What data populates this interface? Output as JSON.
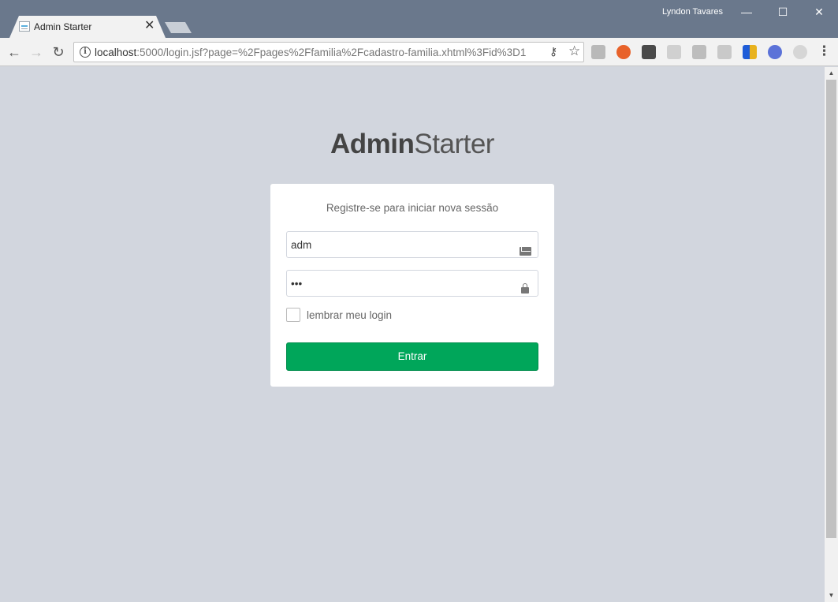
{
  "browser": {
    "tab": {
      "title": "Admin Starter",
      "close": "✕"
    },
    "profile_name": "Lyndon Tavares",
    "window_controls": {
      "minimize": "—",
      "maximize": "☐",
      "close": "✕"
    },
    "nav": {
      "back": "←",
      "forward": "→",
      "reload": "↻"
    },
    "address": {
      "host": "localhost",
      "rest": ":5000/login.jsf?page=%2Fpages%2Ffamilia%2Fcadastro-familia.xhtml%3Fid%3D1"
    },
    "extensions": [
      "acrobat-icon",
      "extension-orange-icon",
      "pocket-icon",
      "extension-gray-icon",
      "camera-icon",
      "extension-doc-icon",
      "extension-color-icon",
      "r-extension-icon",
      "extension-circle-icon"
    ],
    "menu": "⋮"
  },
  "page": {
    "logo": {
      "bold": "Admin",
      "light": "Starter"
    },
    "login": {
      "message": "Registre-se para iniciar nova sessão",
      "username": {
        "value": "adm"
      },
      "password": {
        "value": "adm"
      },
      "remember_label": "lembrar meu login",
      "submit_label": "Entrar"
    }
  },
  "colors": {
    "titlebar": "#6a788c",
    "page_bg": "#d2d6de",
    "button_green": "#00a65a"
  }
}
